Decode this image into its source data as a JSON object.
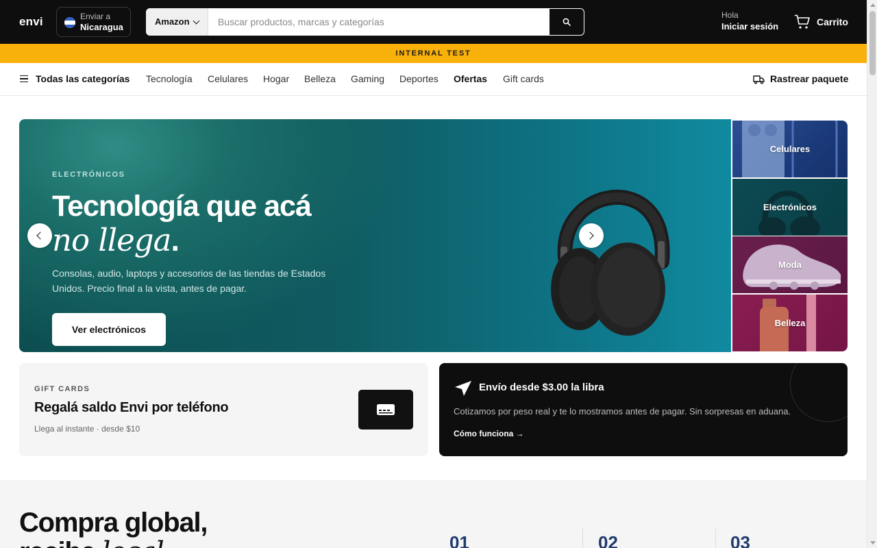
{
  "header": {
    "logo": "envi",
    "ship_to": {
      "label": "Enviar a",
      "country": "Nicaragua",
      "flag_icon": "nicaragua-flag-icon"
    },
    "search": {
      "store": "Amazon",
      "placeholder": "Buscar productos, marcas y categorías",
      "value": ""
    },
    "account": {
      "greeting": "Hola",
      "signin": "Iniciar sesión"
    },
    "cart": {
      "label": "Carrito",
      "icon": "cart-icon"
    }
  },
  "banner": {
    "text": "INTERNAL TEST",
    "color": "#f8b00a"
  },
  "nav": {
    "all_categories": "Todas las categorías",
    "links": [
      "Tecnología",
      "Celulares",
      "Hogar",
      "Belleza",
      "Gaming",
      "Deportes",
      "Ofertas",
      "Gift cards"
    ],
    "track": "Rastrear paquete"
  },
  "hero": {
    "eyebrow": "ELECTRÓNICOS",
    "title_line1": "Tecnología que acá",
    "title_line2": "no llega",
    "title_period": ".",
    "description": "Consolas, audio, laptops y accesorios de las tiendas de Estados Unidos. Precio final a la vista, antes de pagar.",
    "cta": "Ver electrónicos"
  },
  "tiles": [
    "Celulares",
    "Electrónicos",
    "Moda",
    "Belleza"
  ],
  "gift_card": {
    "eyebrow": "GIFT CARDS",
    "title": "Regalá saldo Envi por teléfono",
    "subtitle": "Llega al instante · desde $10"
  },
  "shipping": {
    "title": "Envío desde $3.00 la libra",
    "description": "Cotizamos por peso real y te lo mostramos antes de pagar. Sin sorpresas en aduana.",
    "link": "Cómo funciona →"
  },
  "steps": {
    "title_line1": "Compra global,",
    "title_line2_bold": "recibe",
    "title_line2_italic": "local",
    "numbers": [
      "01",
      "02",
      "03"
    ]
  },
  "colors": {
    "accent": "#f8b00a",
    "dark": "#0e0e0e",
    "hero_teal": "#0f5b61"
  }
}
